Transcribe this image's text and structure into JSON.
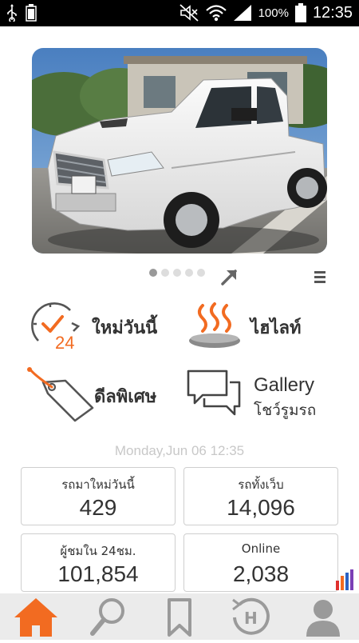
{
  "status_bar": {
    "battery_percent": "100%",
    "time": "12:35",
    "icons": [
      "usb-icon",
      "battery-small-icon",
      "mute-icon",
      "wifi-icon",
      "signal-icon",
      "battery-icon"
    ]
  },
  "carousel": {
    "page_count": 5,
    "active_index": 0
  },
  "tiles": {
    "new_today": {
      "label": "ใหม่วันนี้",
      "badge": "24"
    },
    "highlight": {
      "label": "ไฮไลท์"
    },
    "special_deal": {
      "label": "ดีลพิเศษ"
    },
    "gallery": {
      "label_en": "Gallery",
      "label_th": "โชว์รูมรถ"
    }
  },
  "date_text": "Monday,Jun 06 12:35",
  "stats": [
    {
      "label": "รถมาใหม่วันนี้",
      "value": "429"
    },
    {
      "label": "รถทั้งเว็บ",
      "value": "14,096"
    },
    {
      "label": "ผู้ชมใน 24ชม.",
      "value": "101,854"
    },
    {
      "label": "Online",
      "value": "2,038"
    }
  ],
  "bottom_nav": [
    "home-icon",
    "search-icon",
    "bookmark-icon",
    "history-icon",
    "profile-icon"
  ],
  "colors": {
    "accent": "#f26b21",
    "inactive": "#9a9a9a",
    "nav_bg": "#ebebeb"
  }
}
